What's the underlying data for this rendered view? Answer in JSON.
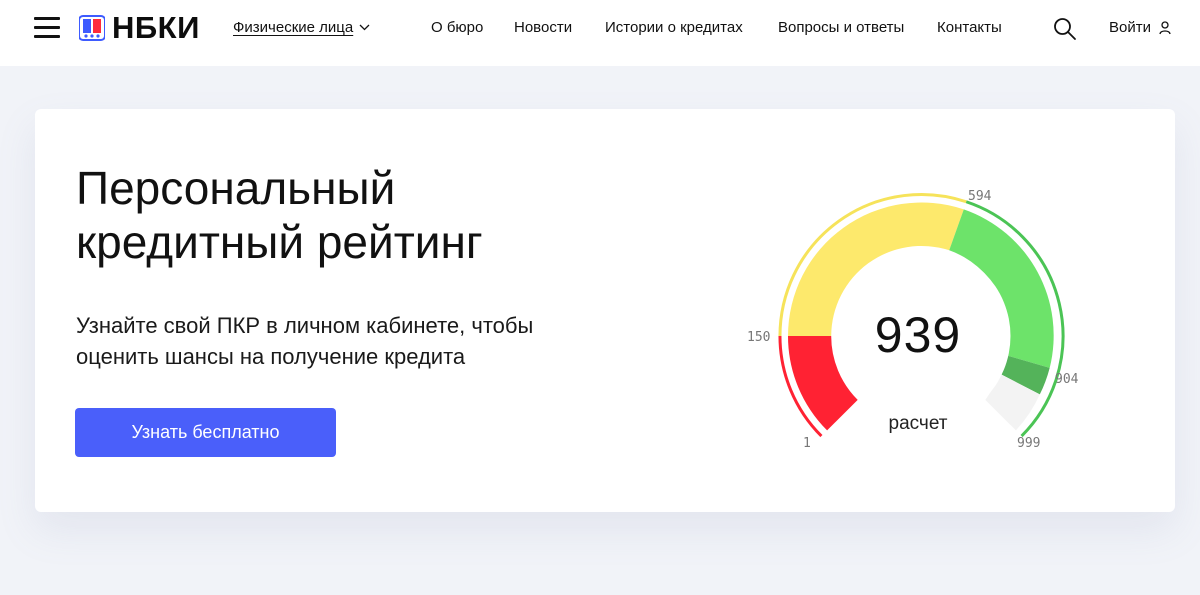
{
  "header": {
    "brand": "НБКИ",
    "segment_label": "Физические лица",
    "nav": {
      "about": "О бюро",
      "news": "Новости",
      "stories": "Истории о кредитах",
      "faq": "Вопросы и ответы",
      "contacts": "Контакты"
    },
    "login_label": "Войти"
  },
  "hero": {
    "title_line1": "Персональный",
    "title_line2": "кредитный рейтинг",
    "subtitle_line1": "Узнайте свой ПКР в личном кабинете, чтобы",
    "subtitle_line2": "оценить шансы на получение кредита",
    "cta_label": "Узнать бесплатно"
  },
  "gauge": {
    "score": "939",
    "caption": "расчет",
    "ticks": {
      "min": "1",
      "t150": "150",
      "t594": "594",
      "t904": "904",
      "max": "999"
    },
    "colors": {
      "red": "#ff2233",
      "yellow": "#fde96c",
      "green": "#6de36a",
      "dark_green": "#54b35a",
      "outline_yellow": "#f6e35a",
      "outline_green": "#4bc455"
    }
  },
  "brand_colors": {
    "primary": "#4a5ffa",
    "logo_blue": "#3e5bff",
    "logo_red": "#ff2b3d"
  }
}
